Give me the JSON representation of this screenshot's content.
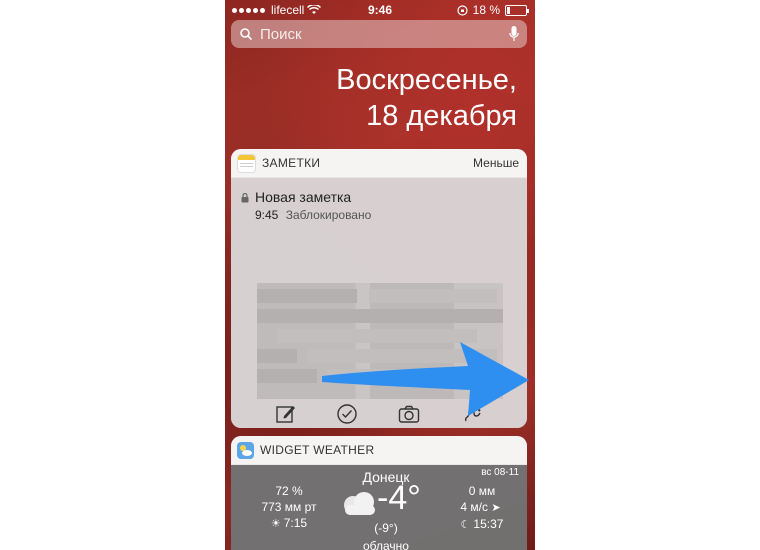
{
  "status_bar": {
    "carrier": "lifecell",
    "time": "9:46",
    "battery_percent": "18 %",
    "battery_level": 0.18
  },
  "search": {
    "placeholder": "Поиск"
  },
  "date": {
    "weekday": "Воскресенье,",
    "day_month": "18 декабря"
  },
  "notes_widget": {
    "title": "ЗАМЕТКИ",
    "toggle_label": "Меньше",
    "note": {
      "title": "Новая заметка",
      "time": "9:45",
      "status": "Заблокировано"
    },
    "toolbar": [
      "compose-icon",
      "checklist-icon",
      "camera-icon",
      "sketch-icon"
    ]
  },
  "weather_widget": {
    "title": "WIDGET WEATHER",
    "city": "Донецк",
    "date": "вс 08-11",
    "temperature": "-4°",
    "feels_like": "(-9°)",
    "condition": "облачно",
    "humidity": "72 %",
    "pressure": "773 мм рт",
    "sunrise": "7:15",
    "precipitation": "0 мм",
    "wind": "4 м/с",
    "sunset": "15:37"
  },
  "colors": {
    "arrow": "#2f8ff0",
    "wallpaper": "#8e2620"
  }
}
